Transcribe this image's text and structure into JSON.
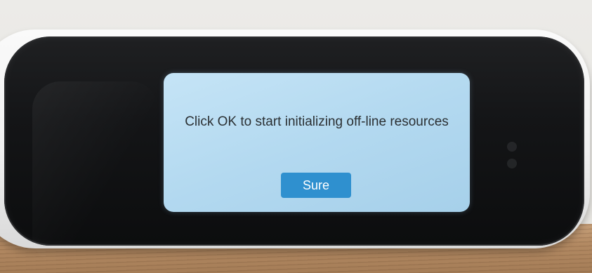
{
  "dialog": {
    "message": "Click OK  to start initializing off-line resources",
    "button_label": "Sure"
  },
  "colors": {
    "dialog_background": "#b3d9f0",
    "button_background": "#2f90cf",
    "button_text": "#ffffff",
    "message_text": "#2b3033",
    "device_shell": "#f5f5f5",
    "device_screen": "#141517"
  }
}
